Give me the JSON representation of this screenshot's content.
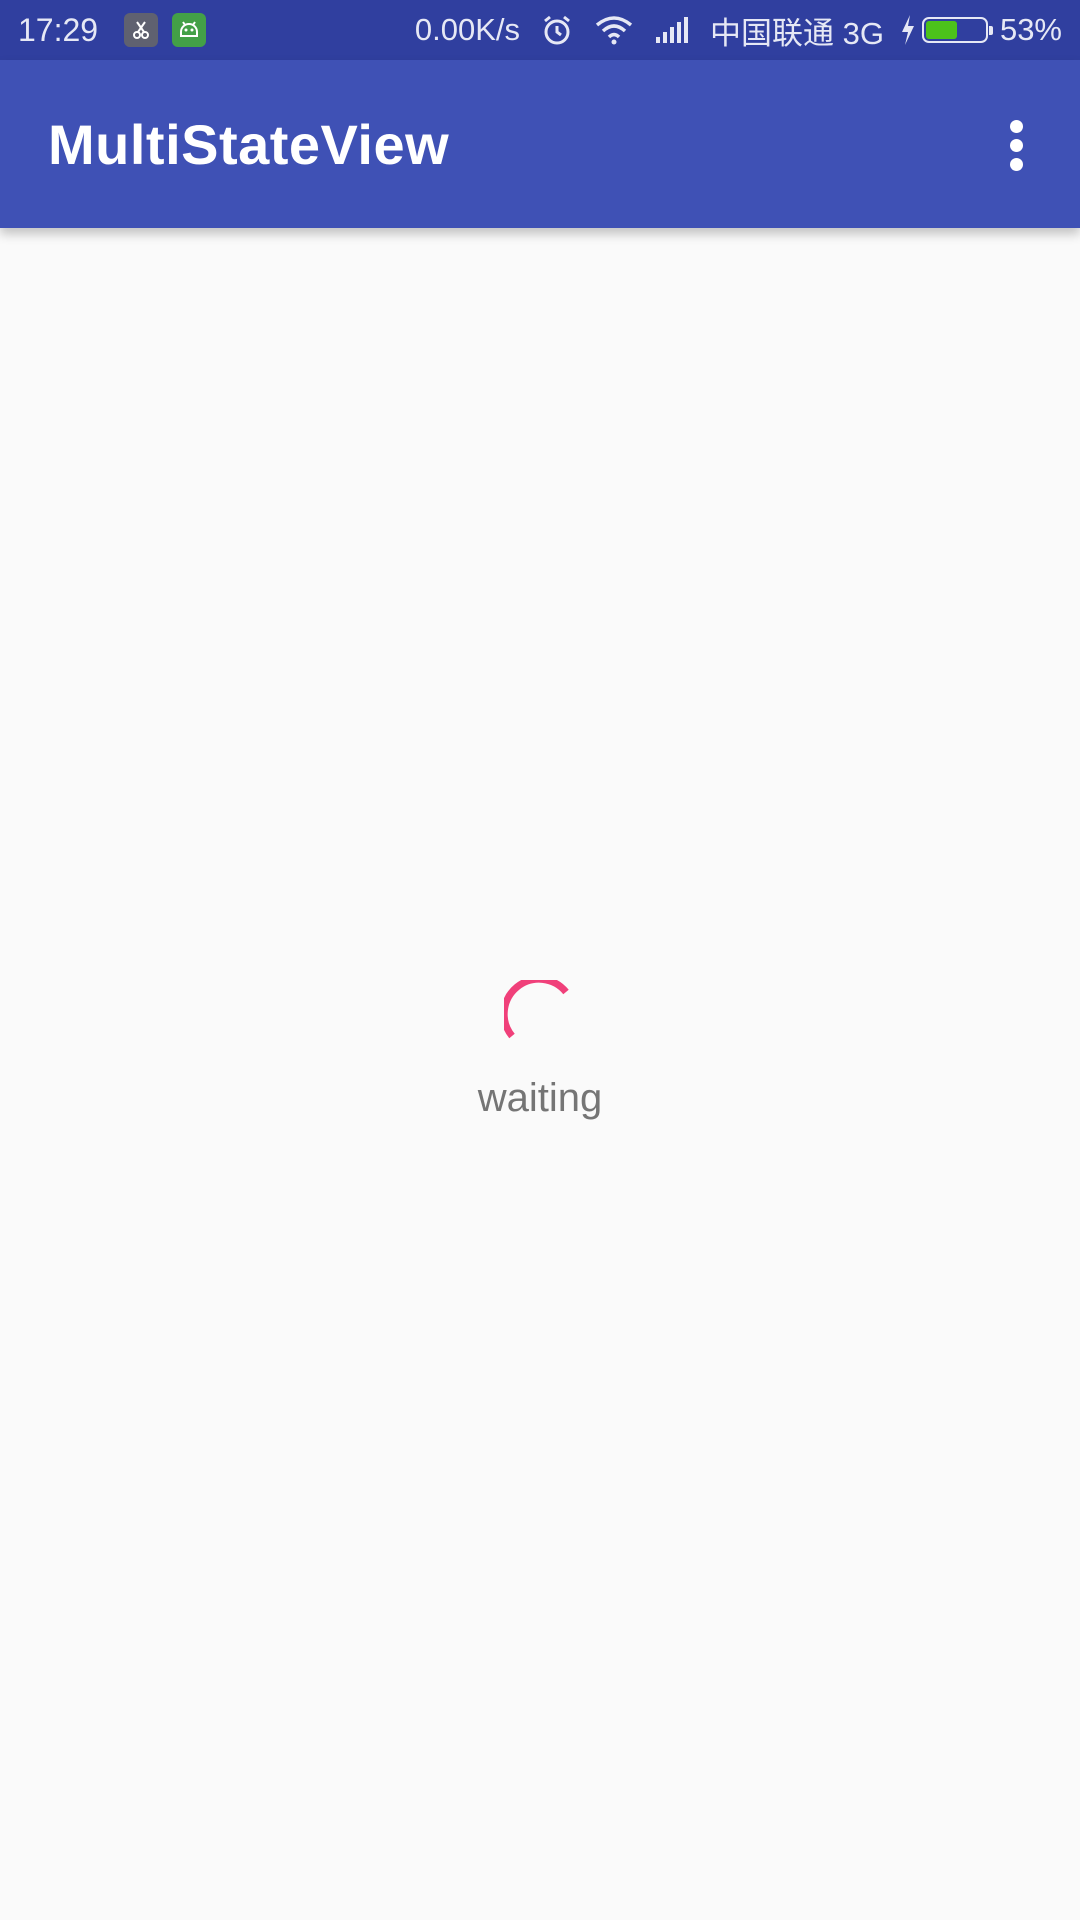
{
  "status_bar": {
    "time": "17:29",
    "notification_icons": [
      "scissors-icon",
      "android-robot-icon"
    ],
    "net_speed": "0.00K/s",
    "carrier": "中国联通 3G",
    "battery_percent": "53%",
    "battery_level": 0.53,
    "icons": [
      "alarm-icon",
      "wifi-icon",
      "signal-icon",
      "charging-bolt-icon",
      "battery-icon"
    ]
  },
  "app_bar": {
    "title": "MultiStateView",
    "menu_icon": "more-vert-icon",
    "color": "#3f51b5"
  },
  "content": {
    "loading_text": "waiting",
    "spinner_color": "#f0407a",
    "background": "#fafafa"
  }
}
